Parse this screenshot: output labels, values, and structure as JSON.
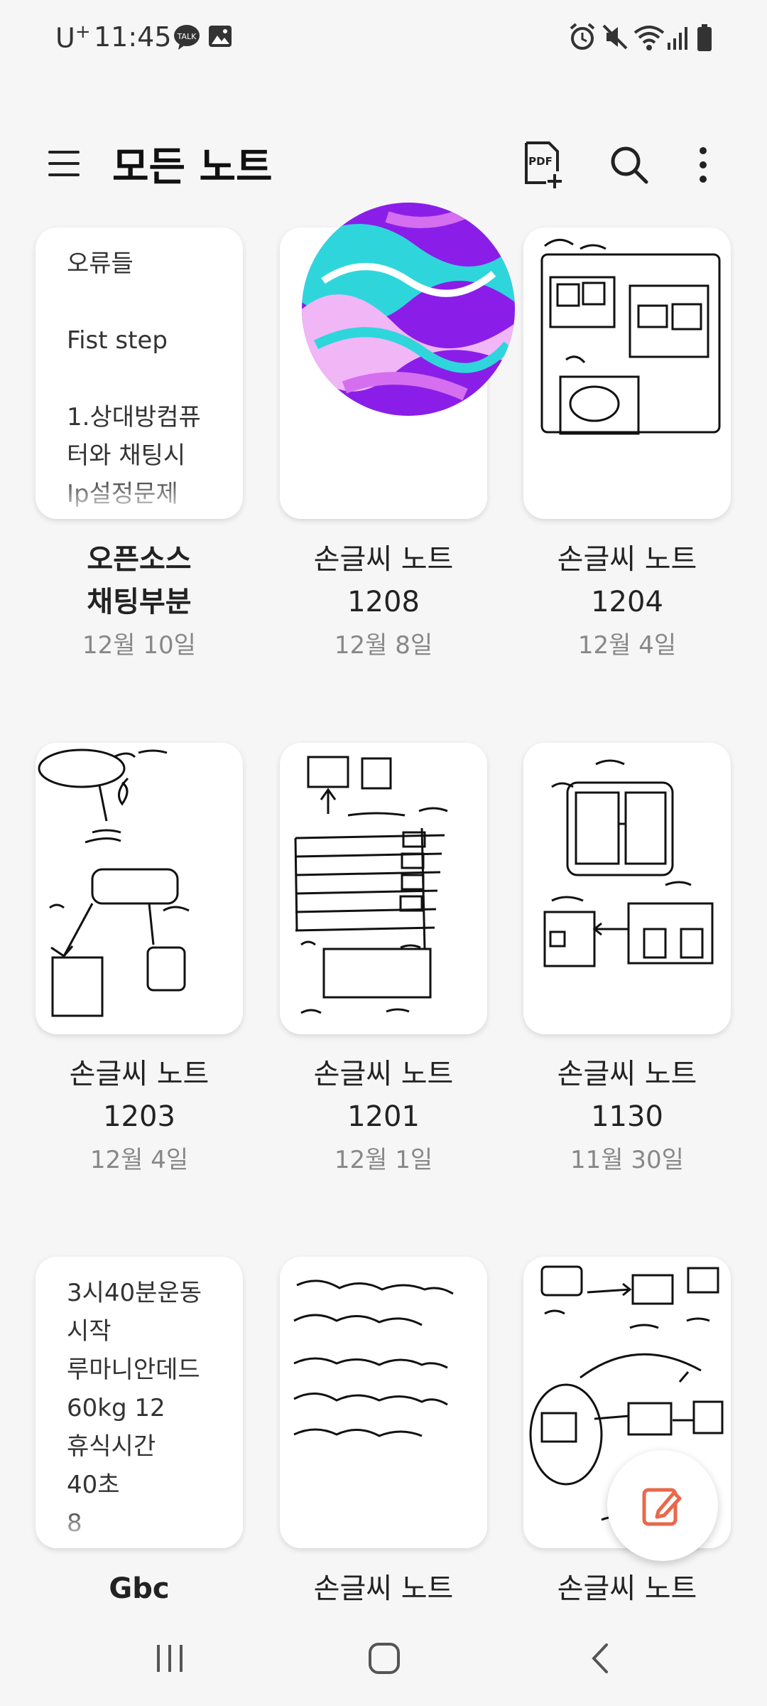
{
  "status_bar": {
    "carrier": "U",
    "carrier_sup": "+",
    "time": "11:45"
  },
  "app_bar": {
    "title": "모든 노트"
  },
  "notes": [
    {
      "type": "text",
      "preview": "오류들\n\nFist step\n\n1.상대방컴퓨\n터와 채팅시\nIp설정문제",
      "title_line1": "오픈소스",
      "title_line2": "채팅부분",
      "date": "12월 10일",
      "bold": true
    },
    {
      "type": "handwriting",
      "title_line1": "손글씨 노트",
      "title_line2": "1208",
      "date": "12월 8일"
    },
    {
      "type": "handwriting",
      "title_line1": "손글씨 노트",
      "title_line2": "1204",
      "date": "12월 4일"
    },
    {
      "type": "handwriting",
      "title_line1": "손글씨 노트",
      "title_line2": "1203",
      "date": "12월 4일"
    },
    {
      "type": "handwriting",
      "title_line1": "손글씨 노트",
      "title_line2": "1201",
      "date": "12월 1일"
    },
    {
      "type": "handwriting",
      "title_line1": "손글씨 노트",
      "title_line2": "1130",
      "date": "11월 30일"
    },
    {
      "type": "text",
      "preview": "3시40분운동\n시작\n루마니안데드\n60kg 12\n휴식시간\n40초\n8",
      "title_line1": "Gbc",
      "bold": true
    },
    {
      "type": "handwriting",
      "title_line1": "손글씨 노트"
    },
    {
      "type": "handwriting",
      "title_line1": "손글씨 노트"
    }
  ],
  "icons": {
    "menu": "hamburger-icon",
    "pdf": "pdf-add-icon",
    "search": "search-icon",
    "more": "more-vert-icon",
    "fab": "compose-icon"
  },
  "colors": {
    "background": "#f6f6f6",
    "fab_icon": "#e8694a",
    "date_text": "#888888"
  }
}
